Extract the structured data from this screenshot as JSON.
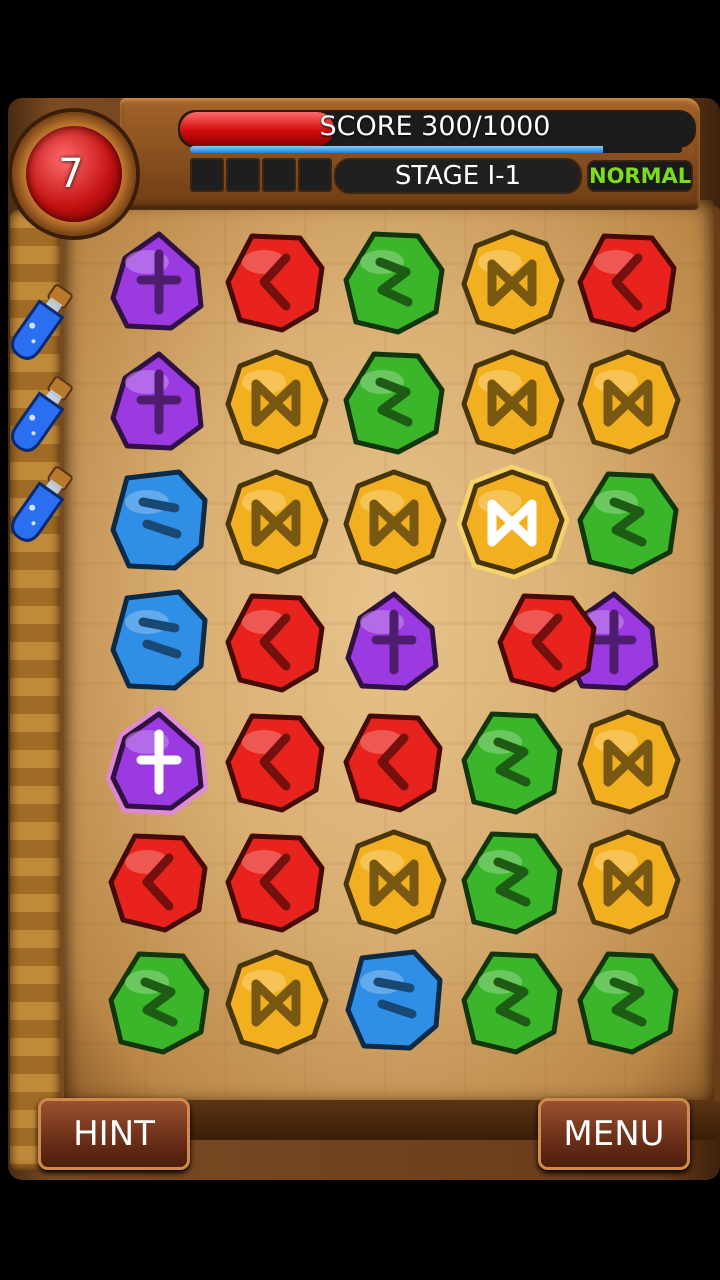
{
  "hud": {
    "moves_left": "7",
    "score_label": "SCORE 300/1000",
    "score_current": 300,
    "score_target": 1000,
    "energy_fraction": 0.84,
    "stage_label": "STAGE I-1",
    "difficulty_label": "NORMAL",
    "empty_slots": 4
  },
  "potions": {
    "count": 3,
    "color": "#2a6ff0"
  },
  "buttons": {
    "hint_label": "HINT",
    "menu_label": "MENU"
  },
  "colors": {
    "purple": "#9b3ae0",
    "red": "#e8221c",
    "green": "#3bb52a",
    "yellow": "#f2b021",
    "blue": "#2f8fe6",
    "glow_yellow": "#ffe066",
    "glow_purple": "#e580ff",
    "difficulty_green": "#7ddc1f"
  },
  "board": {
    "columns": 5,
    "rows": [
      [
        "purple",
        "red",
        "green",
        "yellow",
        "red"
      ],
      [
        "purple",
        "yellow",
        "green",
        "yellow",
        "yellow"
      ],
      [
        "blue",
        "yellow",
        "yellow",
        "yellow",
        "green"
      ],
      [
        "blue",
        "red",
        "purple",
        "red",
        "purple"
      ],
      [
        "purple",
        "red",
        "red",
        "green",
        "yellow"
      ],
      [
        "red",
        "red",
        "yellow",
        "green",
        "yellow"
      ],
      [
        "green",
        "yellow",
        "blue",
        "green",
        "green"
      ]
    ],
    "highlighted": [
      {
        "row": 2,
        "col": 3,
        "glow": "glow_yellow"
      },
      {
        "row": 4,
        "col": 0,
        "glow": "glow_purple"
      }
    ],
    "swapping": {
      "row": 3,
      "col": 3,
      "with_col": 4
    }
  }
}
